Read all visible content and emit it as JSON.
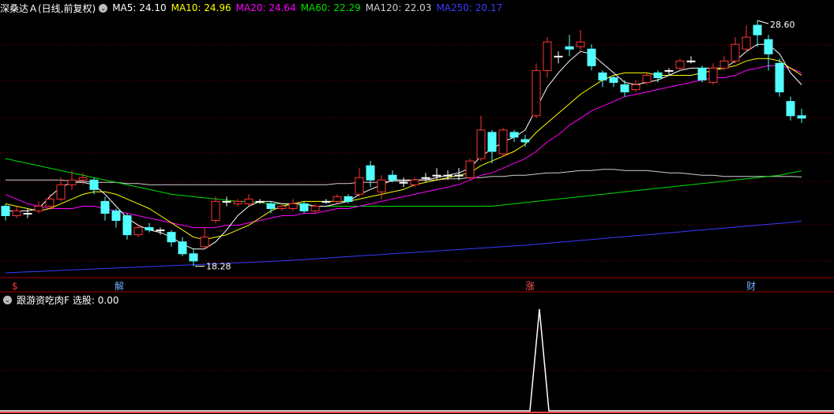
{
  "header": {
    "title": "深桑达Ａ(日线,前复权)",
    "ma": [
      {
        "label": "MA5: 24.10",
        "color": "#ffffff"
      },
      {
        "label": "MA10: 24.96",
        "color": "#ffff00"
      },
      {
        "label": "MA20: 24.64",
        "color": "#ff00ff"
      },
      {
        "label": "MA60: 22.29",
        "color": "#00e000"
      },
      {
        "label": "MA120: 22.03",
        "color": "#d0d0d0"
      },
      {
        "label": "MA250: 20.17",
        "color": "#3a3aff"
      }
    ]
  },
  "indicator": {
    "label": "跟游资吃肉F",
    "value_label": "选股: 0.00"
  },
  "annotations": {
    "high": "28.60",
    "low": "18.28"
  },
  "markers": [
    {
      "text": "$",
      "color": "#ff3333"
    },
    {
      "text": "解",
      "color": "#6fb0ff"
    },
    {
      "text": "涨",
      "color": "#ff5555"
    },
    {
      "text": "财",
      "color": "#6fb0ff"
    }
  ],
  "colors": {
    "up": "#ff3333",
    "down": "#54ffff",
    "grid": "#8b0000"
  },
  "chart_data": {
    "type": "candlestick",
    "price_range": [
      17.8,
      28.8
    ],
    "candles": [
      [
        20.8,
        20.4,
        20.9,
        20.2
      ],
      [
        20.4,
        20.6,
        20.8,
        20.3
      ],
      [
        20.5,
        20.5,
        20.7,
        20.3
      ],
      [
        20.6,
        20.8,
        21.0,
        20.5
      ],
      [
        20.8,
        21.1,
        21.3,
        20.7
      ],
      [
        21.1,
        21.7,
        22.0,
        21.0
      ],
      [
        21.7,
        21.9,
        22.3,
        21.5
      ],
      [
        21.9,
        22.0,
        22.2,
        21.7
      ],
      [
        21.9,
        21.5,
        22.0,
        21.3
      ],
      [
        21.0,
        20.5,
        21.2,
        20.2
      ],
      [
        20.6,
        20.2,
        20.7,
        19.9
      ],
      [
        20.4,
        19.6,
        20.5,
        19.4
      ],
      [
        19.6,
        19.9,
        20.0,
        19.5
      ],
      [
        19.9,
        19.8,
        20.1,
        19.7
      ],
      [
        19.8,
        19.8,
        19.9,
        19.6
      ],
      [
        19.7,
        19.3,
        19.8,
        19.1
      ],
      [
        19.3,
        18.8,
        19.5,
        18.7
      ],
      [
        18.8,
        18.5,
        19.0,
        18.28
      ],
      [
        19.1,
        19.5,
        19.9,
        19.0
      ],
      [
        20.2,
        21.0,
        21.2,
        20.1
      ],
      [
        21.0,
        21.0,
        21.2,
        20.8
      ],
      [
        20.9,
        21.0,
        21.1,
        20.8
      ],
      [
        20.9,
        21.1,
        21.3,
        20.8
      ],
      [
        21.0,
        21.0,
        21.1,
        20.9
      ],
      [
        20.9,
        20.7,
        21.0,
        20.5
      ],
      [
        20.7,
        20.8,
        20.9,
        20.6
      ],
      [
        20.7,
        20.9,
        21.1,
        20.6
      ],
      [
        20.9,
        20.6,
        21.0,
        20.5
      ],
      [
        20.6,
        20.8,
        20.9,
        20.5
      ],
      [
        21.0,
        21.0,
        21.1,
        20.9
      ],
      [
        21.0,
        21.2,
        21.3,
        20.9
      ],
      [
        21.2,
        21.0,
        21.3,
        20.9
      ],
      [
        21.3,
        22.0,
        22.4,
        21.2
      ],
      [
        22.5,
        21.9,
        22.7,
        21.6
      ],
      [
        21.4,
        21.9,
        22.1,
        21.1
      ],
      [
        22.1,
        21.9,
        22.3,
        21.8
      ],
      [
        21.8,
        21.8,
        22.0,
        21.6
      ],
      [
        21.7,
        21.9,
        22.0,
        21.6
      ],
      [
        22.0,
        22.0,
        22.2,
        21.8
      ],
      [
        22.1,
        22.1,
        22.4,
        21.9
      ],
      [
        22.1,
        22.1,
        22.3,
        21.9
      ],
      [
        22.1,
        22.1,
        22.4,
        21.9
      ],
      [
        22.0,
        22.7,
        22.8,
        21.9
      ],
      [
        22.8,
        24.0,
        24.6,
        22.7
      ],
      [
        23.9,
        23.1,
        24.0,
        22.6
      ],
      [
        23.0,
        24.0,
        24.1,
        22.9
      ],
      [
        23.9,
        23.7,
        24.0,
        23.5
      ],
      [
        23.6,
        23.5,
        23.8,
        23.3
      ],
      [
        24.6,
        26.5,
        26.8,
        24.5
      ],
      [
        26.5,
        27.7,
        27.9,
        26.2
      ],
      [
        27.1,
        27.1,
        27.3,
        26.8
      ],
      [
        27.5,
        27.4,
        28.0,
        27.1
      ],
      [
        27.5,
        27.7,
        28.2,
        27.3
      ],
      [
        27.4,
        26.7,
        27.6,
        26.5
      ],
      [
        26.4,
        26.1,
        26.5,
        25.8
      ],
      [
        26.2,
        26.0,
        26.3,
        25.8
      ],
      [
        25.9,
        25.6,
        26.1,
        25.4
      ],
      [
        25.7,
        25.9,
        26.1,
        25.6
      ],
      [
        26.0,
        26.3,
        26.4,
        25.9
      ],
      [
        26.4,
        26.2,
        26.5,
        26.0
      ],
      [
        26.5,
        26.5,
        26.6,
        26.3
      ],
      [
        26.6,
        26.9,
        27.0,
        26.5
      ],
      [
        26.9,
        26.9,
        27.1,
        26.8
      ],
      [
        26.6,
        26.1,
        26.7,
        26.0
      ],
      [
        26.0,
        26.6,
        26.8,
        25.9
      ],
      [
        26.6,
        26.9,
        27.1,
        26.5
      ],
      [
        26.9,
        27.6,
        27.9,
        26.8
      ],
      [
        27.4,
        27.9,
        28.4,
        27.3
      ],
      [
        28.4,
        28.0,
        28.6,
        27.5
      ],
      [
        27.8,
        27.2,
        28.0,
        26.5
      ],
      [
        26.8,
        25.6,
        27.0,
        25.4
      ],
      [
        25.2,
        24.6,
        25.4,
        24.4
      ],
      [
        24.6,
        24.5,
        24.9,
        24.3
      ]
    ],
    "ma5": [
      20.6,
      20.6,
      20.6,
      20.7,
      21.2,
      21.6,
      21.8,
      21.8,
      21.7,
      21.3,
      20.8,
      20.3,
      20.0,
      19.8,
      19.7,
      19.5,
      19.2,
      19.0,
      19.0,
      19.3,
      19.8,
      20.4,
      20.8,
      21.0,
      21.0,
      20.9,
      20.9,
      20.9,
      20.8,
      20.8,
      20.9,
      21.0,
      21.3,
      21.5,
      21.7,
      21.9,
      21.9,
      21.9,
      21.9,
      22.0,
      22.1,
      22.2,
      22.4,
      22.9,
      23.2,
      23.5,
      23.7,
      24.0,
      24.9,
      25.8,
      26.4,
      26.9,
      27.3,
      27.2,
      26.8,
      26.4,
      26.0,
      25.9,
      26.0,
      26.1,
      26.3,
      26.5,
      26.6,
      26.6,
      26.6,
      26.6,
      26.9,
      27.3,
      27.6,
      27.6,
      27.2,
      26.4,
      25.9
    ],
    "ma10": [
      20.9,
      20.8,
      20.7,
      20.6,
      20.7,
      20.9,
      21.1,
      21.3,
      21.4,
      21.4,
      21.3,
      21.1,
      20.9,
      20.7,
      20.4,
      20.1,
      19.8,
      19.5,
      19.4,
      19.5,
      19.6,
      19.8,
      20.0,
      20.3,
      20.6,
      20.8,
      20.9,
      21.0,
      21.0,
      21.0,
      21.0,
      21.0,
      21.1,
      21.2,
      21.3,
      21.4,
      21.5,
      21.7,
      21.8,
      21.9,
      22.0,
      22.1,
      22.2,
      22.5,
      22.7,
      22.9,
      23.1,
      23.4,
      23.9,
      24.3,
      24.7,
      25.1,
      25.5,
      25.8,
      26.1,
      26.3,
      26.4,
      26.4,
      26.4,
      26.3,
      26.3,
      26.3,
      26.3,
      26.4,
      26.5,
      26.6,
      26.7,
      26.9,
      27.0,
      27.0,
      26.9,
      26.6,
      26.3
    ],
    "ma20": [
      21.3,
      21.1,
      20.9,
      20.8,
      20.7,
      20.7,
      20.7,
      20.8,
      20.8,
      20.7,
      20.6,
      20.5,
      20.4,
      20.3,
      20.2,
      20.1,
      20.0,
      19.9,
      19.9,
      19.9,
      20.0,
      20.0,
      20.1,
      20.2,
      20.3,
      20.4,
      20.4,
      20.5,
      20.5,
      20.6,
      20.7,
      20.7,
      20.8,
      20.9,
      21.0,
      21.1,
      21.2,
      21.3,
      21.4,
      21.5,
      21.6,
      21.7,
      21.9,
      22.1,
      22.2,
      22.4,
      22.6,
      22.8,
      23.1,
      23.5,
      23.8,
      24.2,
      24.5,
      24.8,
      25.0,
      25.2,
      25.4,
      25.5,
      25.6,
      25.7,
      25.8,
      25.9,
      26.0,
      26.1,
      26.2,
      26.2,
      26.3,
      26.5,
      26.6,
      26.7,
      26.7,
      26.6,
      26.4
    ],
    "ma60": [
      22.8,
      22.7,
      22.6,
      22.5,
      22.4,
      22.3,
      22.2,
      22.1,
      22.0,
      21.9,
      21.8,
      21.7,
      21.6,
      21.5,
      21.4,
      21.3,
      21.25,
      21.2,
      21.15,
      21.1,
      21.05,
      21.0,
      21.0,
      20.95,
      20.9,
      20.9,
      20.85,
      20.85,
      20.8,
      20.8,
      20.8,
      20.8,
      20.8,
      20.8,
      20.8,
      20.8,
      20.8,
      20.8,
      20.8,
      20.8,
      20.8,
      20.8,
      20.8,
      20.8,
      20.8,
      20.85,
      20.9,
      20.95,
      21.0,
      21.05,
      21.1,
      21.15,
      21.2,
      21.25,
      21.3,
      21.35,
      21.4,
      21.45,
      21.5,
      21.55,
      21.6,
      21.65,
      21.7,
      21.75,
      21.8,
      21.85,
      21.9,
      21.95,
      22.0,
      22.05,
      22.1,
      22.2,
      22.29
    ],
    "ma120": [
      21.9,
      21.9,
      21.9,
      21.9,
      21.9,
      21.9,
      21.85,
      21.85,
      21.8,
      21.8,
      21.8,
      21.75,
      21.75,
      21.7,
      21.7,
      21.7,
      21.7,
      21.7,
      21.7,
      21.7,
      21.7,
      21.7,
      21.7,
      21.7,
      21.7,
      21.7,
      21.7,
      21.7,
      21.7,
      21.7,
      21.75,
      21.75,
      21.8,
      21.8,
      21.8,
      21.85,
      21.85,
      21.9,
      21.9,
      21.9,
      21.95,
      21.95,
      22.0,
      22.0,
      22.05,
      22.05,
      22.1,
      22.1,
      22.15,
      22.2,
      22.2,
      22.25,
      22.3,
      22.3,
      22.35,
      22.35,
      22.3,
      22.3,
      22.3,
      22.25,
      22.2,
      22.2,
      22.15,
      22.1,
      22.1,
      22.05,
      22.05,
      22.05,
      22.05,
      22.05,
      22.05,
      22.05,
      22.03
    ],
    "ma250": [
      18.0,
      18.02,
      18.04,
      18.06,
      18.08,
      18.1,
      18.12,
      18.14,
      18.16,
      18.18,
      18.2,
      18.22,
      18.24,
      18.26,
      18.28,
      18.3,
      18.32,
      18.34,
      18.36,
      18.38,
      18.4,
      18.42,
      18.44,
      18.46,
      18.48,
      18.5,
      18.53,
      18.56,
      18.59,
      18.62,
      18.65,
      18.68,
      18.71,
      18.74,
      18.77,
      18.8,
      18.83,
      18.86,
      18.89,
      18.92,
      18.95,
      18.98,
      19.01,
      19.04,
      19.07,
      19.1,
      19.13,
      19.16,
      19.2,
      19.24,
      19.28,
      19.32,
      19.36,
      19.4,
      19.44,
      19.48,
      19.52,
      19.56,
      19.6,
      19.64,
      19.68,
      19.72,
      19.76,
      19.8,
      19.84,
      19.88,
      19.92,
      19.96,
      20.0,
      20.04,
      20.08,
      20.12,
      20.17
    ],
    "signal": {
      "index": 48,
      "value": 1
    }
  }
}
